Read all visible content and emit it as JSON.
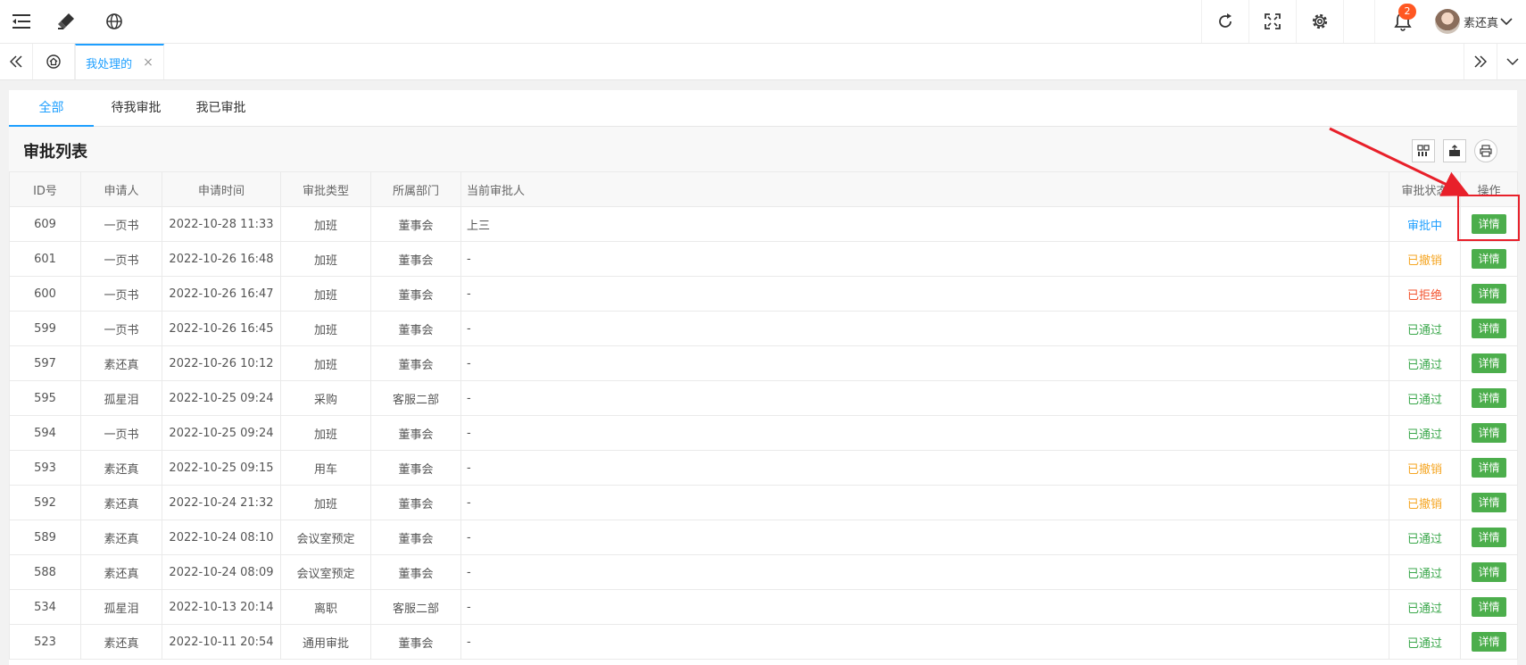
{
  "header": {
    "notification_count": "2",
    "user_name": "素还真"
  },
  "tabs_bar": {
    "active_tab_label": "我处理的",
    "close_glyph": "×"
  },
  "sub_tabs": [
    {
      "label": "全部",
      "active": true
    },
    {
      "label": "待我审批",
      "active": false
    },
    {
      "label": "我已审批",
      "active": false
    }
  ],
  "list": {
    "title": "审批列表",
    "columns": [
      "ID号",
      "申请人",
      "申请时间",
      "审批类型",
      "所属部门",
      "当前审批人",
      "审批状态",
      "操作"
    ],
    "action_label": "详情",
    "status_colors": {
      "审批中": "#1e9fff",
      "已撤销": "#f5a623",
      "已拒绝": "#f3532e",
      "已通过": "#3aa74b"
    },
    "rows": [
      {
        "id": "609",
        "applicant": "一页书",
        "time": "2022-10-28 11:33",
        "type": "加班",
        "dept": "董事会",
        "approver": "上三",
        "status": "审批中"
      },
      {
        "id": "601",
        "applicant": "一页书",
        "time": "2022-10-26 16:48",
        "type": "加班",
        "dept": "董事会",
        "approver": "-",
        "status": "已撤销"
      },
      {
        "id": "600",
        "applicant": "一页书",
        "time": "2022-10-26 16:47",
        "type": "加班",
        "dept": "董事会",
        "approver": "-",
        "status": "已拒绝"
      },
      {
        "id": "599",
        "applicant": "一页书",
        "time": "2022-10-26 16:45",
        "type": "加班",
        "dept": "董事会",
        "approver": "-",
        "status": "已通过"
      },
      {
        "id": "597",
        "applicant": "素还真",
        "time": "2022-10-26 10:12",
        "type": "加班",
        "dept": "董事会",
        "approver": "-",
        "status": "已通过"
      },
      {
        "id": "595",
        "applicant": "孤星泪",
        "time": "2022-10-25 09:24",
        "type": "采购",
        "dept": "客服二部",
        "approver": "-",
        "status": "已通过"
      },
      {
        "id": "594",
        "applicant": "一页书",
        "time": "2022-10-25 09:24",
        "type": "加班",
        "dept": "董事会",
        "approver": "-",
        "status": "已通过"
      },
      {
        "id": "593",
        "applicant": "素还真",
        "time": "2022-10-25 09:15",
        "type": "用车",
        "dept": "董事会",
        "approver": "-",
        "status": "已撤销"
      },
      {
        "id": "592",
        "applicant": "素还真",
        "time": "2022-10-24 21:32",
        "type": "加班",
        "dept": "董事会",
        "approver": "-",
        "status": "已撤销"
      },
      {
        "id": "589",
        "applicant": "素还真",
        "time": "2022-10-24 08:10",
        "type": "会议室预定",
        "dept": "董事会",
        "approver": "-",
        "status": "已通过"
      },
      {
        "id": "588",
        "applicant": "素还真",
        "time": "2022-10-24 08:09",
        "type": "会议室预定",
        "dept": "董事会",
        "approver": "-",
        "status": "已通过"
      },
      {
        "id": "534",
        "applicant": "孤星泪",
        "time": "2022-10-13 20:14",
        "type": "离职",
        "dept": "客服二部",
        "approver": "-",
        "status": "已通过"
      },
      {
        "id": "523",
        "applicant": "素还真",
        "time": "2022-10-11 20:54",
        "type": "通用审批",
        "dept": "董事会",
        "approver": "-",
        "status": "已通过"
      }
    ]
  },
  "icons": {
    "top_left": [
      "menu-fold-icon",
      "theme-brush-icon",
      "globe-icon"
    ],
    "top_right": [
      "refresh-icon",
      "fullscreen-icon",
      "settings-gear-icon",
      "bell-icon"
    ],
    "tabs_bar": [
      "double-chevron-left-icon",
      "home-icon",
      "double-chevron-right-icon",
      "chevron-down-icon"
    ],
    "toolbar": [
      "columns-filter-icon",
      "export-icon",
      "print-icon"
    ]
  },
  "annotation": {
    "color": "#e8202a"
  }
}
